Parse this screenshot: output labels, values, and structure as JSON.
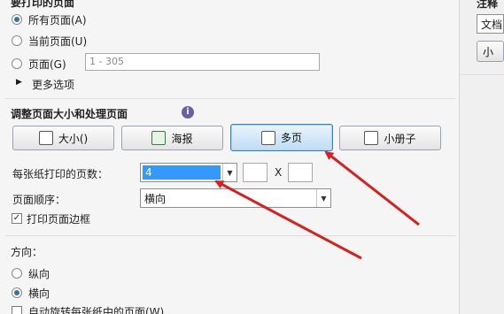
{
  "pages_section": {
    "title": "要打印的页面",
    "all_pages": "所有页面(A)",
    "current_page": "当前页面(U)",
    "pages_label": "页面(G)",
    "pages_placeholder": "1 - 305",
    "more_options": "更多选项"
  },
  "resize_section": {
    "title": "调整页面大小和处理页面",
    "buttons": [
      {
        "label": "大小()"
      },
      {
        "label": "海报"
      },
      {
        "label": "多页",
        "active": true
      },
      {
        "label": "小册子"
      }
    ],
    "pages_per_sheet_label": "每张纸打印的页数：",
    "pages_per_sheet_value": "4",
    "x_sep": "X",
    "page_order_label": "页面顺序：",
    "page_order_value": "横向",
    "print_border": "打印页面边框"
  },
  "orientation_section": {
    "title": "方向：",
    "portrait": "纵向",
    "landscape": "横向",
    "auto_rotate": "自动旋转每张纸中的页面(W)"
  },
  "comments_panel": {
    "title": "注释",
    "select_value": "文档",
    "button": "小"
  },
  "colors": {
    "arrow": "#d81e1e",
    "active_button": "#bfdcf5",
    "selection": "#3399ff"
  }
}
